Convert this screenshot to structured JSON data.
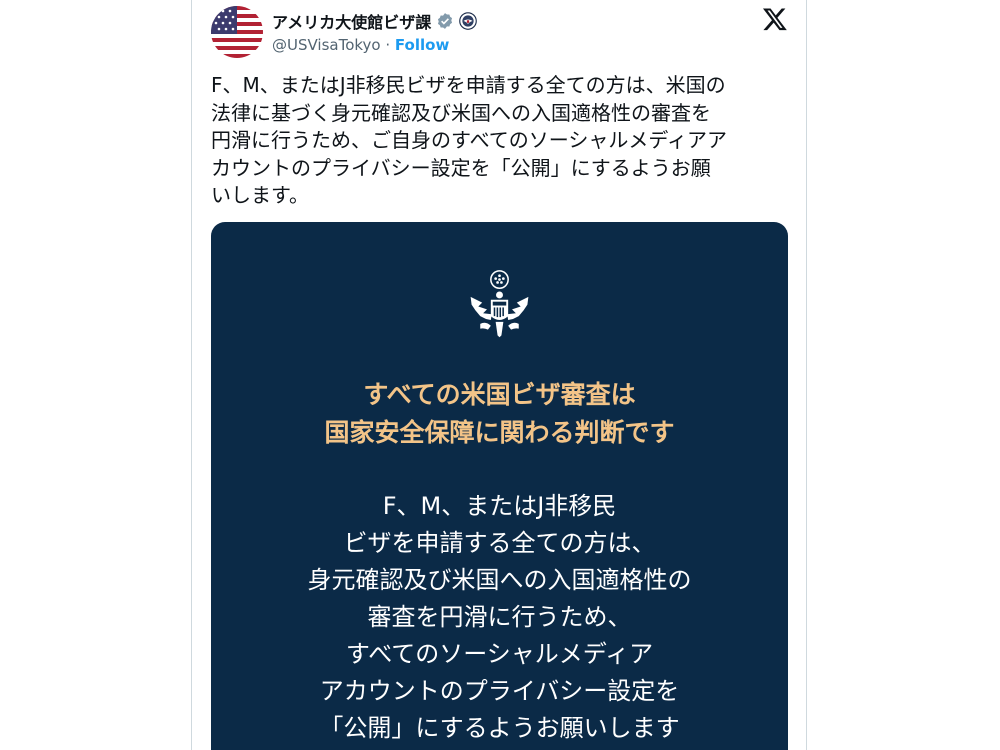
{
  "account": {
    "display_name": "アメリカ大使館ビザ課",
    "handle": "@USVisaTokyo",
    "separator": " · ",
    "follow_label": "Follow"
  },
  "icons": {
    "avatar": "us-flag-avatar",
    "verified": "verified-badge-icon",
    "affiliate": "state-department-seal-icon",
    "x": "x-logo-icon"
  },
  "colors": {
    "link": "#1d9bf0",
    "media_background": "#0b2a47",
    "headline": "#f3c488"
  },
  "tweet": {
    "lines": [
      "F、M、またはJ非移民ビザを申請する全ての方は、米国の",
      "法律に基づく身元確認及び米国への入国適格性の審査を",
      "円滑に行うため、ご自身のすべてのソーシャルメディアア",
      "カウントのプライバシー設定を「公開」にするようお願",
      "いします。"
    ]
  },
  "media": {
    "headline": [
      "すべての米国ビザ審査は",
      "国家安全保障に関わる判断です"
    ],
    "body": [
      "F、M、またはJ非移民",
      "ビザを申請する全ての方は、",
      "身元確認及び米国への入国適格性の",
      "審査を円滑に行うため、",
      "すべてのソーシャルメディア",
      "アカウントのプライバシー設定を",
      "「公開」にするようお願いします"
    ]
  }
}
